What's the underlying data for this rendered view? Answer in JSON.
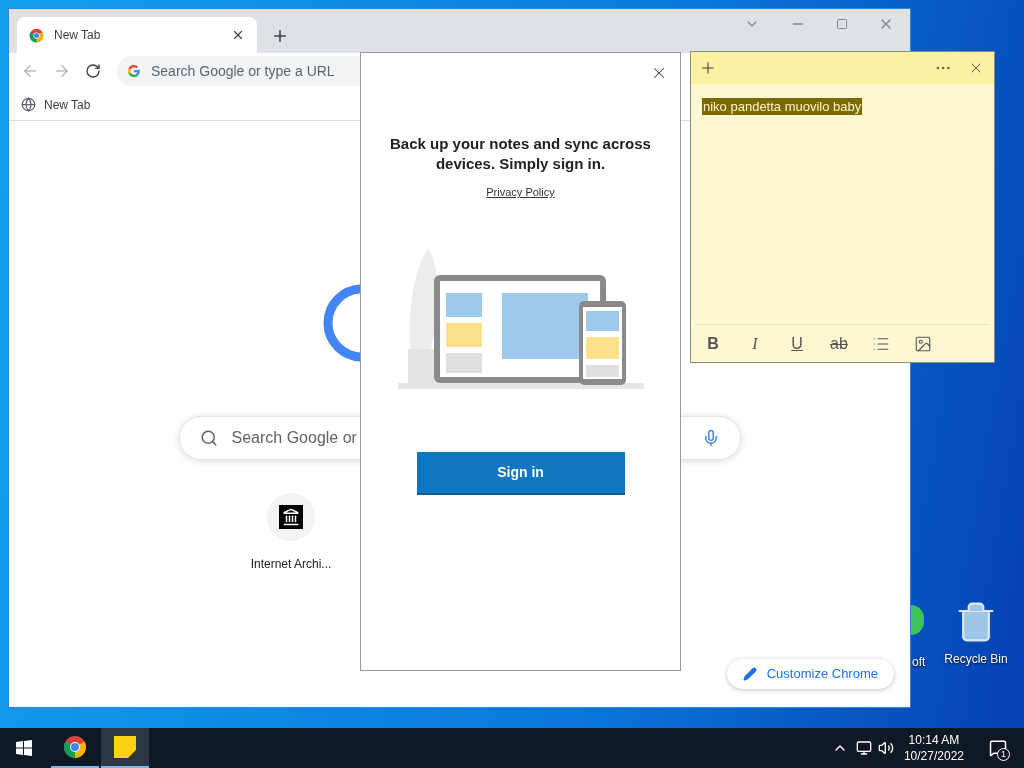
{
  "desktop_icons": [
    {
      "label": "oft"
    },
    {
      "label": "Recycle Bin"
    }
  ],
  "browser": {
    "tabs": [
      {
        "title": "New Tab",
        "selected": true
      }
    ],
    "omnibox": {
      "placeholder": "Search Google or type a URL"
    },
    "bookmarks": [
      {
        "label": "New Tab"
      }
    ],
    "search": {
      "placeholder": "Search Google or"
    },
    "shortcuts": [
      {
        "label": "Internet Archi..."
      }
    ],
    "customize_button": "Customize Chrome"
  },
  "sign_in_dialog": {
    "message": "Back up your notes and sync across devices. Simply sign in.",
    "privacy_link": "Privacy Policy",
    "button": "Sign in"
  },
  "sticky_note": {
    "text": "niko pandetta muovilo baby",
    "selected": true,
    "toolbar": [
      {
        "kind": "bold",
        "label": "B"
      },
      {
        "kind": "italic",
        "label": "I"
      },
      {
        "kind": "underline",
        "label": "U"
      },
      {
        "kind": "strike",
        "label": "ab"
      },
      {
        "kind": "bullets"
      },
      {
        "kind": "image"
      }
    ]
  },
  "taskbar": {
    "apps": [
      {
        "kind": "chrome",
        "selected": false
      },
      {
        "kind": "notes",
        "selected": true
      }
    ],
    "time": "10:14 AM",
    "date": "10/27/2022",
    "notification_count": "1"
  }
}
